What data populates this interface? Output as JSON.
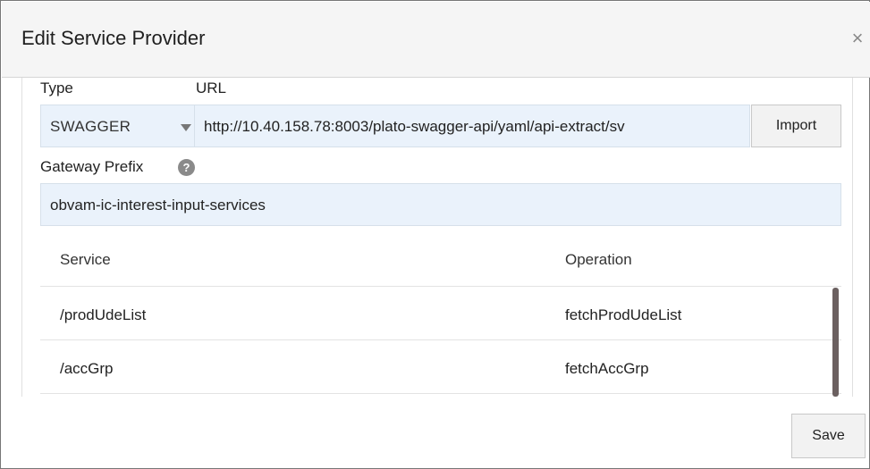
{
  "dialog": {
    "title": "Edit Service Provider",
    "close_glyph": "×"
  },
  "form": {
    "type_label": "Type",
    "url_label": "URL",
    "type_value": "SWAGGER",
    "url_value": "http://10.40.158.78:8003/plato-swagger-api/yaml/api-extract/sv",
    "import_label": "Import",
    "gateway_label": "Gateway Prefix",
    "help_glyph": "?",
    "gateway_value": "obvam-ic-interest-input-services"
  },
  "table": {
    "columns": [
      "Service",
      "Operation"
    ],
    "rows": [
      {
        "service": "/prodUdeList",
        "operation": "fetchProdUdeList"
      },
      {
        "service": "/accGrp",
        "operation": "fetchAccGrp"
      }
    ]
  },
  "footer": {
    "save_label": "Save"
  },
  "colors": {
    "input_bg": "#eaf2fb",
    "header_bg": "#f5f5f5",
    "scroll_thumb": "#6b6060"
  },
  "icons": {
    "close": "close-icon",
    "help": "help-icon",
    "dropdown": "chevron-down-icon"
  }
}
